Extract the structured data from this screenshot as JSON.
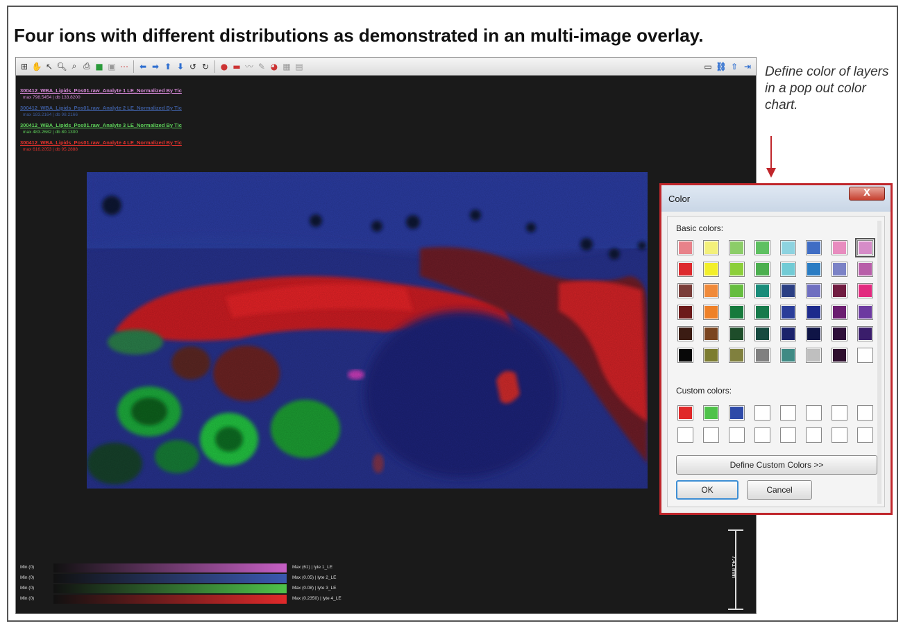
{
  "page": {
    "title": "Four ions with different distributions as demonstrated in an multi-image overlay."
  },
  "toolbar": {
    "icons": [
      "grid-icon",
      "pan-icon",
      "pointer-icon",
      "zoom-in-icon",
      "zoom-out-icon",
      "print-icon",
      "green-icon",
      "image-icon",
      "more-icon",
      "arrow-left-icon",
      "arrow-right-icon",
      "arrow-up-icon",
      "arrow-down-icon",
      "rotate-left-icon",
      "rotate-right-icon",
      "point-icon",
      "rect-icon",
      "line-icon",
      "pen-icon",
      "paint-icon",
      "table-icon",
      "grid-small-icon"
    ],
    "right_icons": [
      "window-icon",
      "link-icon",
      "export-icon",
      "forward-icon"
    ]
  },
  "layers": [
    {
      "name": "300412_WBA_Lipids_Pos01.raw_Analyte 1 LE_Normalized By Tic",
      "stat": "max 798.5454 | db 133.8200",
      "color": "#d88ad9"
    },
    {
      "name": "300412_WBA_Lipids_Pos01.raw_Analyte 2 LE_Normalized By Tic",
      "stat": "max 183.2164 | db 98.2166",
      "color": "#3c5a9a"
    },
    {
      "name": "300412_WBA_Lipids_Pos01.raw_Analyte 3 LE_Normalized By Tic",
      "stat": "max 483.2682 | db 80.1300",
      "color": "#5ed15a"
    },
    {
      "name": "300412_WBA_Lipids_Pos01.raw_Analyte 4 LE_Normalized By Tic",
      "stat": "max 616.2053 | db 95.2888",
      "color": "#e5322d"
    }
  ],
  "colorbars": [
    {
      "min": "Min (0)",
      "max": "Max (61) | lyte 1_LE",
      "color": "#c65fc4"
    },
    {
      "min": "Min (0)",
      "max": "Max (0.05) | lyte 2_LE",
      "color": "#3a58b0"
    },
    {
      "min": "Min (0)",
      "max": "Max (0.08) | lyte 3_LE",
      "color": "#4fc24a"
    },
    {
      "min": "Min (0)",
      "max": "Max (0.2350) | lyte 4_LE",
      "color": "#e0292a"
    }
  ],
  "scale_bar": {
    "label": "7.41 mm"
  },
  "annotation": {
    "text": "Define color of layers in a pop out color chart.",
    "color": "#c0262b"
  },
  "dialog": {
    "title": "Color",
    "close_label": "X",
    "basic_colors_label": "Basic colors:",
    "custom_colors_label": "Custom colors:",
    "define_custom_label": "Define Custom Colors >>",
    "ok_label": "OK",
    "cancel_label": "Cancel",
    "basic_colors": [
      "#e8828a",
      "#f3f07a",
      "#8ccd68",
      "#5ec061",
      "#8dd3e0",
      "#3f6dc4",
      "#e88cbf",
      "#d68cc8",
      "#dd2a2e",
      "#f2ef2a",
      "#8ccf3a",
      "#4caf4f",
      "#72cbd5",
      "#2a7cc3",
      "#7b82c6",
      "#b85fa9",
      "#7a3e3a",
      "#f08a3a",
      "#66bd3f",
      "#1a8c7a",
      "#2b3f83",
      "#6f6fc0",
      "#701c40",
      "#e22a7f",
      "#6c1a1a",
      "#ef8128",
      "#167a3c",
      "#167a4b",
      "#2a3d99",
      "#1d2a8c",
      "#6b1d70",
      "#6c3aa0",
      "#3b1c13",
      "#7a4520",
      "#1e4d2a",
      "#164a3f",
      "#1b236b",
      "#0f1446",
      "#2e0f3a",
      "#3a1d6b",
      "#080808",
      "#7c7c30",
      "#80803e",
      "#808080",
      "#3f8a84",
      "#bfbfbf",
      "#2e0f2e",
      "#ffffff"
    ],
    "selected_index": 7,
    "custom_colors": [
      "#e0292a",
      "#4fc24a",
      "#2e4aa8",
      "#ffffff",
      "#ffffff",
      "#ffffff",
      "#ffffff",
      "#ffffff",
      "#ffffff",
      "#ffffff",
      "#ffffff",
      "#ffffff",
      "#ffffff",
      "#ffffff",
      "#ffffff",
      "#ffffff"
    ]
  }
}
